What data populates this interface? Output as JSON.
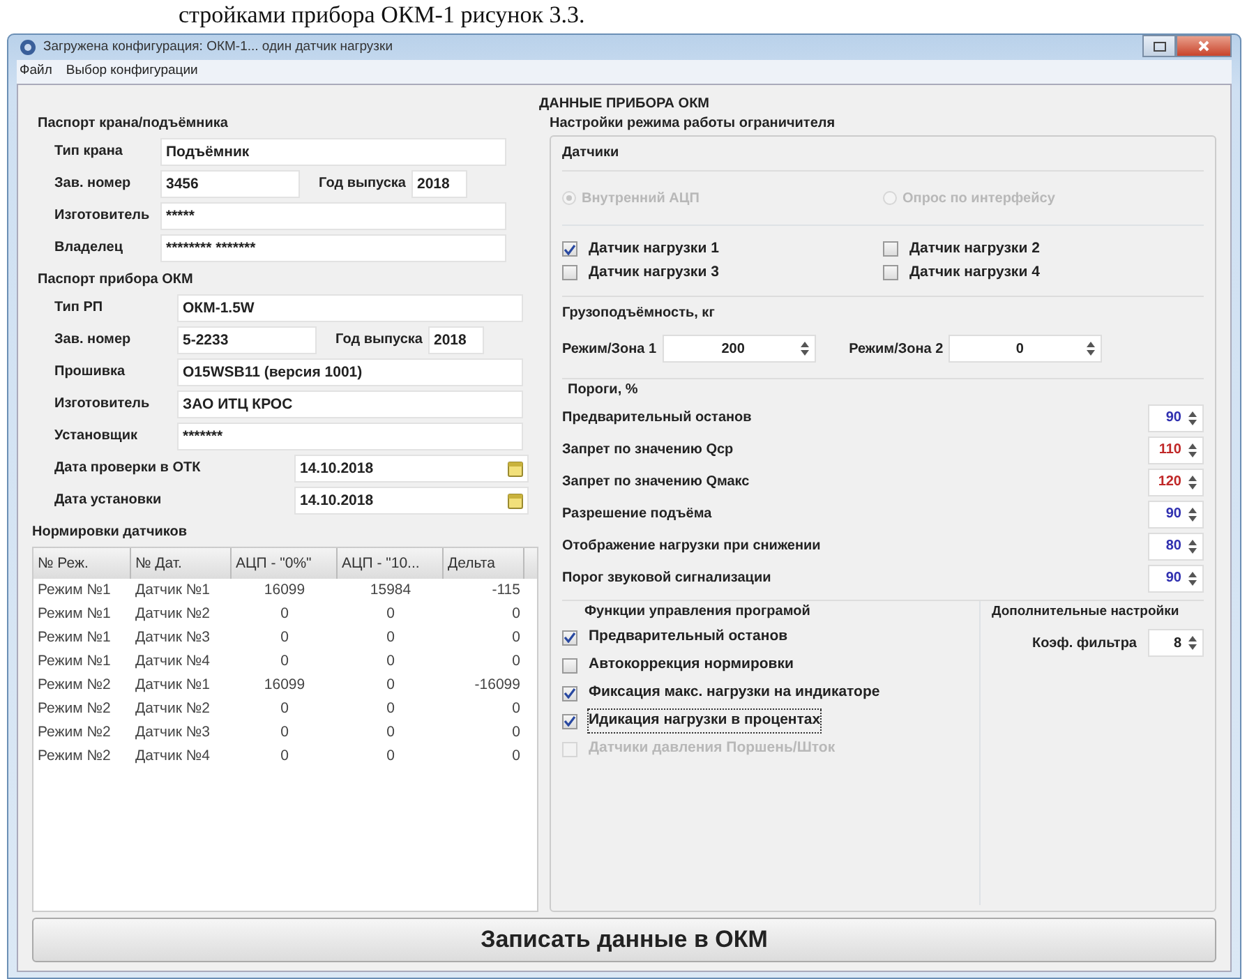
{
  "document_caption": "стройками прибора ОКМ-1 рисунок 3.3.",
  "window": {
    "title": "Загружена конфигурация: ОКМ-1... один датчик нагрузки"
  },
  "menu": [
    "Файл",
    "Выбор конфигурации"
  ],
  "heading": "ДАННЫЕ ПРИБОРА ОКМ",
  "crane_passport": {
    "title": "Паспорт крана/подъёмника",
    "rows": [
      {
        "fields": [
          {
            "label": "Тип крана",
            "value": "Подъёмник"
          }
        ]
      },
      {
        "fields": [
          {
            "label": "Зав. номер",
            "value": "3456"
          },
          {
            "label": "Год выпуска",
            "value": "2018"
          }
        ]
      },
      {
        "fields": [
          {
            "label": "Изготовитель",
            "value": "*****"
          }
        ]
      },
      {
        "fields": [
          {
            "label": "Владелец",
            "value": "******** *******"
          }
        ]
      }
    ]
  },
  "device_passport": {
    "title": "Паспорт прибора ОКМ",
    "rows": [
      {
        "fields": [
          {
            "label": "Тип РП",
            "value": "ОКМ-1.5W"
          }
        ]
      },
      {
        "fields": [
          {
            "label": "Зав. номер",
            "value": "5-2233"
          },
          {
            "label": "Год выпуска",
            "value": "2018"
          }
        ]
      },
      {
        "fields": [
          {
            "label": "Прошивка",
            "value": "О15WSB11 (версия 1001)"
          }
        ]
      },
      {
        "fields": [
          {
            "label": "Изготовитель",
            "value": "ЗАО ИТЦ КРОС"
          }
        ]
      },
      {
        "fields": [
          {
            "label": "Установщик",
            "value": "*******"
          }
        ]
      }
    ],
    "dates": [
      {
        "label": "Дата проверки в ОТК",
        "value": "14.10.2018"
      },
      {
        "label": "Дата установки",
        "value": "14.10.2018"
      }
    ]
  },
  "normalization": {
    "title": "Нормировки датчиков",
    "columns": [
      "№ Реж.",
      "№ Дат.",
      "АЦП - \"0%\"",
      "АЦП - \"10...",
      "Дельта"
    ],
    "rows": [
      [
        "Режим №1",
        "Датчик №1",
        "16099",
        "15984",
        "-115"
      ],
      [
        "Режим №1",
        "Датчик №2",
        "0",
        "0",
        "0"
      ],
      [
        "Режим №1",
        "Датчик №3",
        "0",
        "0",
        "0"
      ],
      [
        "Режим №1",
        "Датчик №4",
        "0",
        "0",
        "0"
      ],
      [
        "Режим №2",
        "Датчик №1",
        "16099",
        "0",
        "-16099"
      ],
      [
        "Режим №2",
        "Датчик №2",
        "0",
        "0",
        "0"
      ],
      [
        "Режим №2",
        "Датчик №3",
        "0",
        "0",
        "0"
      ],
      [
        "Режим №2",
        "Датчик №4",
        "0",
        "0",
        "0"
      ]
    ]
  },
  "settings": {
    "title": "Настройки режима работы ограничителя",
    "sensors": {
      "title": "Датчики",
      "radios": [
        {
          "label": "Внутренний АЦП",
          "selected": true,
          "disabled": true
        },
        {
          "label": "Опрос по интерфейсу",
          "selected": false,
          "disabled": true
        }
      ],
      "checkboxes": [
        {
          "label": "Датчик нагрузки 1",
          "checked": true
        },
        {
          "label": "Датчик нагрузки 2",
          "checked": false
        },
        {
          "label": "Датчик нагрузки 3",
          "checked": false
        },
        {
          "label": "Датчик нагрузки 4",
          "checked": false
        }
      ]
    },
    "capacity": {
      "title": "Грузоподъёмность, кг",
      "zones": [
        {
          "label": "Режим/Зона 1",
          "value": "200"
        },
        {
          "label": "Режим/Зона 2",
          "value": "0"
        }
      ]
    },
    "thresholds": {
      "title": "Пороги, %",
      "items": [
        {
          "label": "Предварительный останов",
          "value": "90",
          "color": "#3030b0"
        },
        {
          "label": "Запрет по значению Qср",
          "value": "110",
          "color": "#c02828"
        },
        {
          "label": "Запрет по значению Qмакс",
          "value": "120",
          "color": "#c02828"
        },
        {
          "label": "Разрешение подъёма",
          "value": "90",
          "color": "#3030b0"
        },
        {
          "label": "Отображение нагрузки при снижении",
          "value": "80",
          "color": "#3030b0"
        },
        {
          "label": "Порог звуковой сигнализации",
          "value": "90",
          "color": "#3030b0"
        }
      ]
    },
    "functions": {
      "title": "Функции управления програмой",
      "items": [
        {
          "label": "Предварительный останов",
          "checked": true,
          "disabled": false,
          "focused": false
        },
        {
          "label": "Автокоррекция нормировки",
          "checked": false,
          "disabled": false,
          "focused": false
        },
        {
          "label": "Фиксация макс. нагрузки на индикаторе",
          "checked": true,
          "disabled": false,
          "focused": false
        },
        {
          "label": "Идикация нагрузки в процентах",
          "checked": true,
          "disabled": false,
          "focused": true
        },
        {
          "label": "Датчики давления Поршень/Шток",
          "checked": false,
          "disabled": true,
          "focused": false
        }
      ]
    },
    "extra": {
      "title": "Дополнительные настройки",
      "filter": {
        "label": "Коэф. фильтра",
        "value": "8"
      }
    }
  },
  "write_button": "Записать данные в ОКМ"
}
